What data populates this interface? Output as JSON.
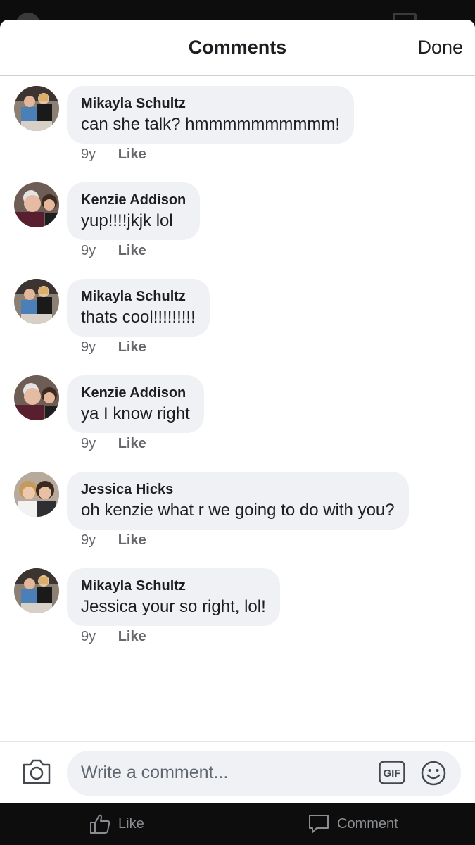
{
  "header": {
    "title": "Comments",
    "done_label": "Done"
  },
  "comments": [
    {
      "author": "Mikayla Schultz",
      "text": "can she talk? hmmmmmmmmmm!",
      "age": "9y",
      "like_label": "Like",
      "avatar": "mikayla"
    },
    {
      "author": "Kenzie Addison",
      "text": "yup!!!!jkjk lol",
      "age": "9y",
      "like_label": "Like",
      "avatar": "kenzie"
    },
    {
      "author": "Mikayla Schultz",
      "text": "thats cool!!!!!!!!!",
      "age": "9y",
      "like_label": "Like",
      "avatar": "mikayla"
    },
    {
      "author": "Kenzie Addison",
      "text": "ya I know right",
      "age": "9y",
      "like_label": "Like",
      "avatar": "kenzie"
    },
    {
      "author": "Jessica Hicks",
      "text": "oh kenzie what r we going to do with you?",
      "age": "9y",
      "like_label": "Like",
      "avatar": "jessica"
    },
    {
      "author": "Mikayla Schultz",
      "text": "Jessica your so right, lol!",
      "age": "9y",
      "like_label": "Like",
      "avatar": "mikayla"
    }
  ],
  "composer": {
    "placeholder": "Write a comment...",
    "camera_icon": "camera-icon",
    "gif_label": "GIF",
    "emoji_icon": "smiley-icon"
  },
  "bottom_bar": {
    "like_label": "Like",
    "comment_label": "Comment"
  },
  "colors": {
    "bubble": "#f0f1f5",
    "meta": "#65676b",
    "bar": "#0d0d0d"
  }
}
